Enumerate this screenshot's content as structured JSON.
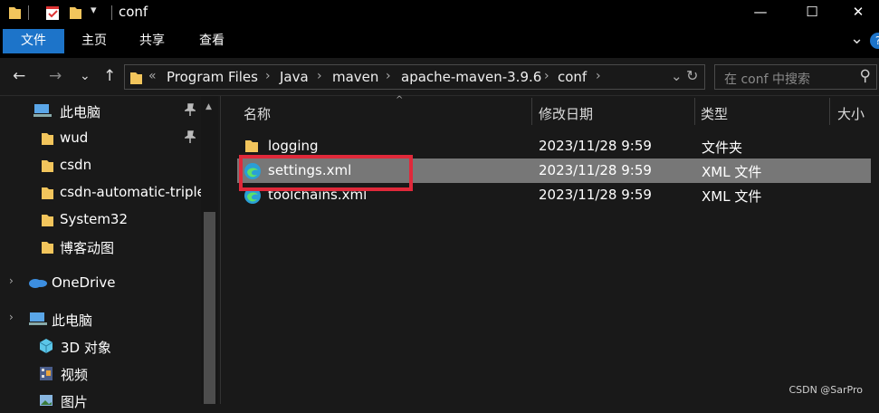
{
  "window": {
    "title": "conf",
    "quick_access_caret": "▾",
    "controls": {
      "minimize": "—",
      "maximize": "☐",
      "close": "✕"
    }
  },
  "ribbon": {
    "tabs": [
      {
        "label": "文件",
        "active": true
      },
      {
        "label": "主页",
        "active": false
      },
      {
        "label": "共享",
        "active": false
      },
      {
        "label": "查看",
        "active": false
      }
    ],
    "expand_glyph": "⌄",
    "help_glyph": "?"
  },
  "nav": {
    "back": "←",
    "forward": "→",
    "recent": "⌄",
    "up": "↑",
    "overflow": "«",
    "breadcrumb": [
      "Program Files",
      "Java",
      "maven",
      "apache-maven-3.9.6",
      "conf"
    ],
    "dropdown_glyph": "⌄",
    "refresh_glyph": "↻",
    "search_placeholder": "在 conf 中搜索",
    "search_glyph": "⚲"
  },
  "sidebar": {
    "items": [
      {
        "label": "此电脑",
        "icon": "pc-icon",
        "pinned": true
      },
      {
        "label": "wud",
        "icon": "folder-icon",
        "pinned": true
      },
      {
        "label": "csdn",
        "icon": "folder-icon",
        "pinned": false
      },
      {
        "label": "csdn-automatic-triple",
        "icon": "folder-icon",
        "pinned": false
      },
      {
        "label": "System32",
        "icon": "folder-icon",
        "pinned": false
      },
      {
        "label": "博客动图",
        "icon": "folder-icon",
        "pinned": false
      },
      {
        "label": "OneDrive",
        "icon": "cloud-icon",
        "pinned": false
      },
      {
        "label": "此电脑",
        "icon": "pc-icon",
        "pinned": false
      },
      {
        "label": "3D 对象",
        "icon": "cube-icon",
        "pinned": false
      },
      {
        "label": "视频",
        "icon": "video-icon",
        "pinned": false
      },
      {
        "label": "图片",
        "icon": "picture-icon",
        "pinned": false
      }
    ],
    "scroll_up_glyph": "▲",
    "expand_glyph": "›"
  },
  "columns": {
    "name": "名称",
    "modified": "修改日期",
    "type": "类型",
    "size": "大小",
    "sort_glyph": "^"
  },
  "files": [
    {
      "name": "logging",
      "modified": "2023/11/28 9:59",
      "type": "文件夹",
      "icon": "folder-icon",
      "selected": false
    },
    {
      "name": "settings.xml",
      "modified": "2023/11/28 9:59",
      "type": "XML 文件",
      "icon": "edge-icon",
      "selected": true
    },
    {
      "name": "toolchains.xml",
      "modified": "2023/11/28 9:59",
      "type": "XML 文件",
      "icon": "edge-icon",
      "selected": false
    }
  ],
  "watermark": "CSDN @SarPro",
  "colors": {
    "accent": "#1d74c9",
    "highlight": "#e0293a",
    "folder": "#f2c55c",
    "selected_row": "#777777"
  }
}
